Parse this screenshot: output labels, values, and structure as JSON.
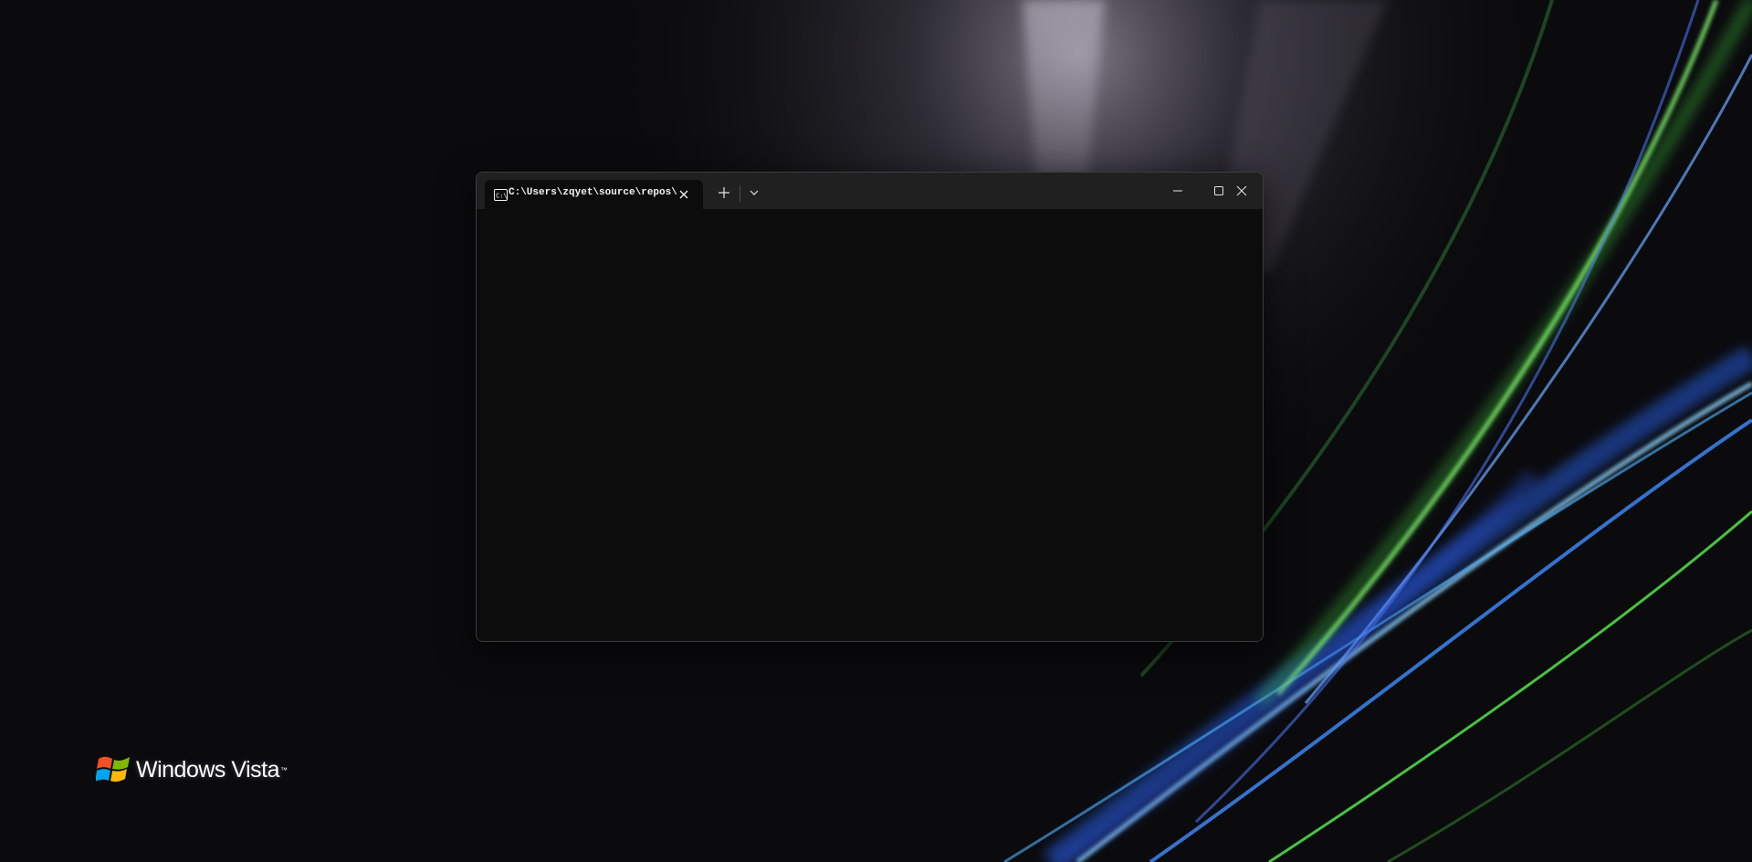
{
  "desktop": {
    "logo": {
      "text": "Windows Vista",
      "trademark": "™"
    }
  },
  "terminal": {
    "tab": {
      "title": "C:\\Users\\zqyet\\source\\repos\\",
      "icon": "cmd-icon"
    },
    "buttons": {
      "new_tab_icon": "plus-icon",
      "dropdown_icon": "chevron-down-icon",
      "minimize_icon": "minimize-icon",
      "maximize_icon": "maximize-icon",
      "close_icon": "close-icon"
    },
    "colors": {
      "titlebar": "#202020",
      "background": "#0c0c0c",
      "text": "#f2f2f2"
    }
  },
  "colors": {
    "wallpaper_base": "#0b0b0e",
    "aurora_green": "#55e34a",
    "aurora_blue": "#3f8cff",
    "aurora_cyan": "#8fd6ff"
  }
}
